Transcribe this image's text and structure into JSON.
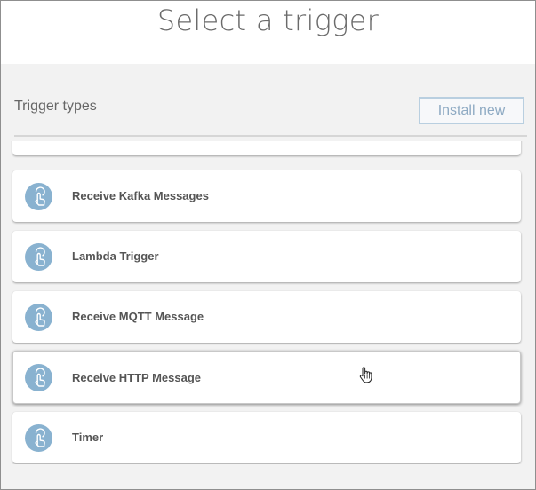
{
  "header": {
    "title": "Select a trigger"
  },
  "toolbar": {
    "section_label": "Trigger types",
    "install_label": "Install new"
  },
  "triggers": [
    {
      "label": "Receive Kafka Messages",
      "icon": "tap-hand-icon"
    },
    {
      "label": "Lambda Trigger",
      "icon": "tap-hand-icon"
    },
    {
      "label": "Receive MQTT Message",
      "icon": "tap-hand-icon"
    },
    {
      "label": "Receive HTTP Message",
      "icon": "tap-hand-icon"
    },
    {
      "label": "Timer",
      "icon": "tap-hand-icon"
    }
  ],
  "colors": {
    "icon_bg": "#89b2d0",
    "install_border": "#b9cfe0",
    "install_text": "#8eaac3"
  }
}
